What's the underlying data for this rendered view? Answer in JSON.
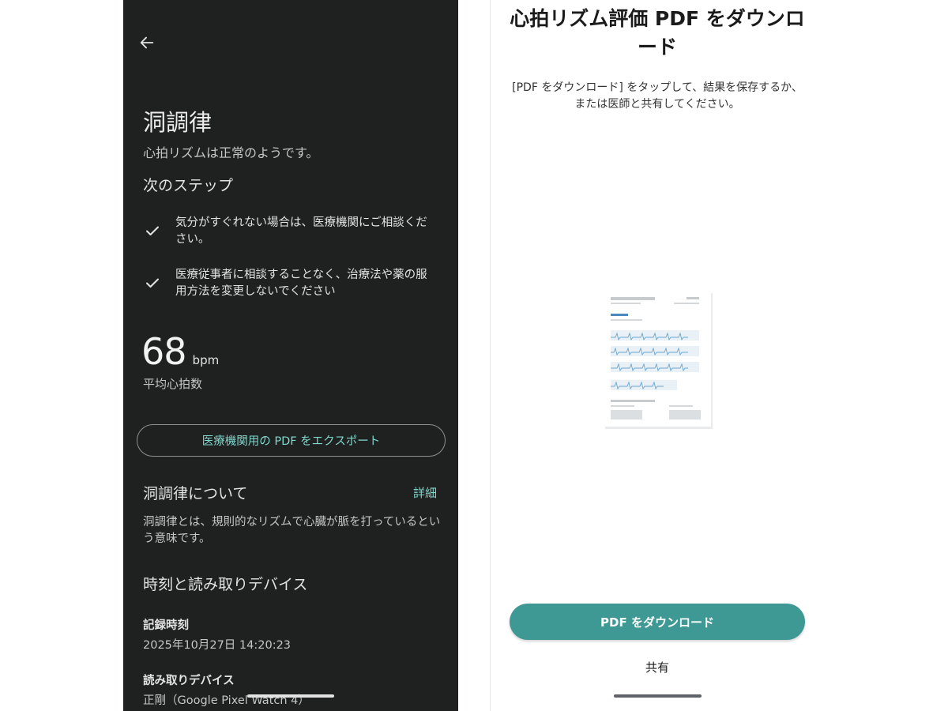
{
  "left_screen": {
    "result_title": "洞調律",
    "result_subtitle": "心拍リズムは正常のようです。",
    "next_steps_heading": "次のステップ",
    "steps": [
      {
        "icon": "check-icon",
        "text_line1": "気分がすぐれない場合は、医療機関にご相談くだ",
        "text_line2": "さい。"
      },
      {
        "icon": "check-icon",
        "text_line1": "医療従事者に相談することなく、治療法や薬の服",
        "text_line2": "用方法を変更しないでください"
      }
    ],
    "bpm_value": "68",
    "bpm_unit": "bpm",
    "bpm_label": "平均心拍数",
    "export_button": "医療機関用の PDF をエクスポート",
    "about_title": "洞調律について",
    "about_more": "詳細",
    "about_body_line1": "洞調律とは、規則的なリズムで心臓が脈を打っているとい",
    "about_body_line2": "う意味です。",
    "time_device_title": "時刻と読み取りデバイス",
    "record_time_label": "記録時刻",
    "record_time_value": "2025年10月27日 14:20:23",
    "device_label": "読み取りデバイス",
    "device_value": "正剛（Google Pixel Watch 4）",
    "accent_color": "#7fd8cc",
    "background_color": "#1f2020"
  },
  "right_screen": {
    "title_line1": "心拍リズム評価 PDF をダウンロ",
    "title_line2": "ード",
    "desc_line1": "[PDF をダウンロード] をタップして、結果を保存するか、",
    "desc_line2": "または医師と共有してください。",
    "download_button": "PDF をダウンロード",
    "share_button": "共有",
    "button_color": "#3e9995"
  }
}
